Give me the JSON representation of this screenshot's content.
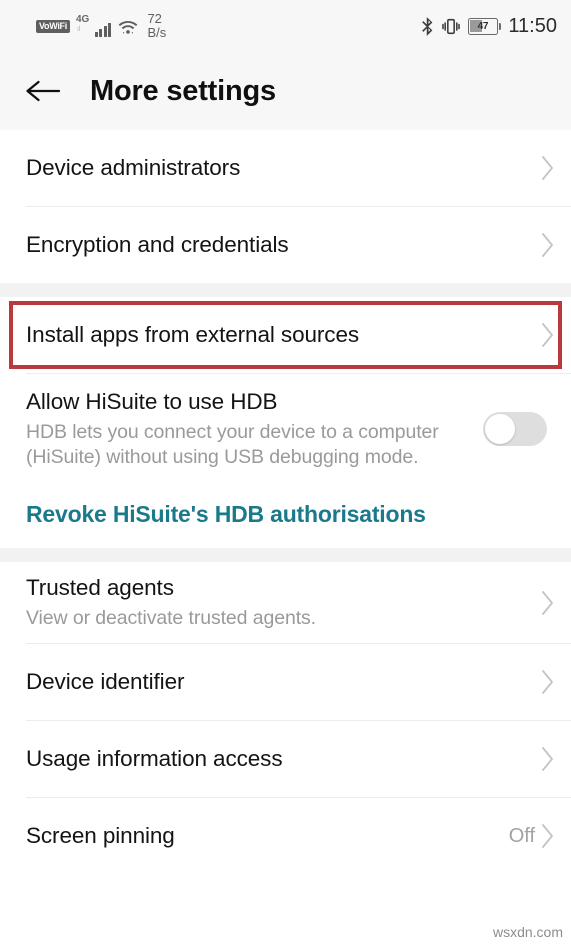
{
  "statusbar": {
    "carrier_badge": "VoWiFi",
    "network_type": "4G",
    "network_plus": "+",
    "network_sub": "ıl",
    "speed_value": "72",
    "speed_unit": "B/s",
    "bluetooth_icon": "bluetooth-icon",
    "vibrate_icon": "vibrate-icon",
    "battery_level": "47",
    "time": "11:50"
  },
  "header": {
    "back_icon": "back-arrow-icon",
    "title": "More settings"
  },
  "list": {
    "section1": [
      {
        "title": "Device administrators",
        "chevron": true
      },
      {
        "title": "Encryption and credentials",
        "chevron": true
      }
    ],
    "highlighted": {
      "title": "Install apps from external sources",
      "chevron": true,
      "highlight_color": "#b83a3a"
    },
    "hdb": {
      "title": "Allow HiSuite to use HDB",
      "subtitle": "HDB lets you connect your device to a computer (HiSuite) without using USB debugging mode.",
      "toggle_state": "off"
    },
    "revoke_link": {
      "label": "Revoke HiSuite's HDB authorisations",
      "color": "#1a7a8c"
    },
    "section3": [
      {
        "title": "Trusted agents",
        "subtitle": "View or deactivate trusted agents.",
        "value": "",
        "chevron": true
      },
      {
        "title": "Device identifier",
        "subtitle": "",
        "value": "",
        "chevron": true
      },
      {
        "title": "Usage information access",
        "subtitle": "",
        "value": "",
        "chevron": true
      },
      {
        "title": "Screen pinning",
        "subtitle": "",
        "value": "Off",
        "chevron": true
      }
    ]
  },
  "watermark": "wsxdn.com"
}
